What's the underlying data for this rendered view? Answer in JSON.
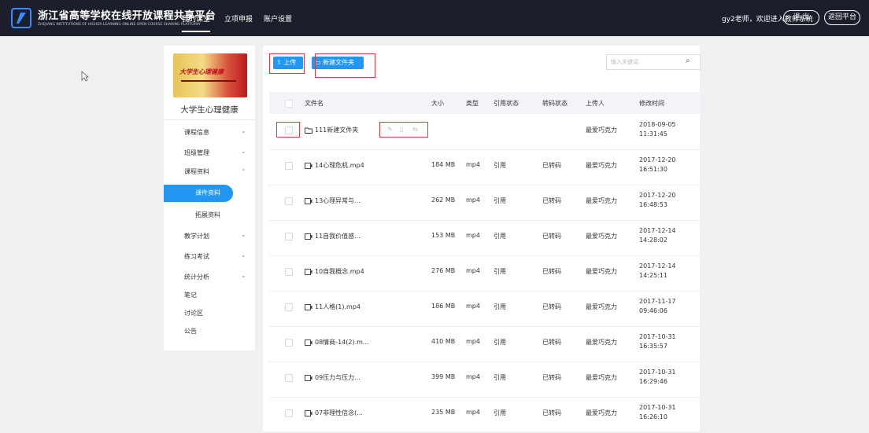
{
  "header": {
    "site_title": "浙江省高等学校在线开放课程共享平台",
    "site_subtitle": "ZHEJIANG INSTITUTIONS OF HIGHER LEARNING ONLINE OPEN COURSE SHARING PLATFORM",
    "nav": [
      "我的课堂",
      "立项申报",
      "账户设置"
    ],
    "welcome": "gy2老师，欢迎进入教师系统",
    "logout_label": "退 出",
    "return_label": "返回平台"
  },
  "sidebar": {
    "banner_text": "大学生心理健康",
    "course_name": "大学生心理健康",
    "menu": {
      "course_info": "课程信息",
      "class_mgmt": "班级管理",
      "materials": "课程资料",
      "courseware": "课件资料",
      "extended": "拓展资料",
      "teaching_plan": "教学计划",
      "exercises": "练习考试",
      "stats": "统计分析",
      "notes": "笔记",
      "discussion": "讨论区",
      "notice": "公告"
    }
  },
  "toolbar": {
    "upload_label": "上传",
    "new_folder_label": "新建文件夹",
    "search_placeholder": "输入关键词"
  },
  "table": {
    "headers": {
      "name": "文件名",
      "size": "大小",
      "type": "类型",
      "ref": "引用状态",
      "trans": "转码状态",
      "uploader": "上传人",
      "modified": "修改时间"
    },
    "rows": [
      {
        "name": "111新建文件夹",
        "size": "",
        "type": "",
        "ref": "",
        "trans": "",
        "uploader": "最爱巧克力",
        "date": "2018-09-05",
        "time": "11:31:45"
      },
      {
        "name": "14心理危机.mp4",
        "size": "184 MB",
        "type": "mp4",
        "ref": "引用",
        "trans": "已转码",
        "uploader": "最爱巧克力",
        "date": "2017-12-20",
        "time": "16:51:30"
      },
      {
        "name": "13心理异常与...",
        "size": "262 MB",
        "type": "mp4",
        "ref": "引用",
        "trans": "已转码",
        "uploader": "最爱巧克力",
        "date": "2017-12-20",
        "time": "16:48:53"
      },
      {
        "name": "11自我价值感...",
        "size": "153 MB",
        "type": "mp4",
        "ref": "引用",
        "trans": "已转码",
        "uploader": "最爱巧克力",
        "date": "2017-12-14",
        "time": "14:28:02"
      },
      {
        "name": "10自我概念.mp4",
        "size": "276 MB",
        "type": "mp4",
        "ref": "引用",
        "trans": "已转码",
        "uploader": "最爱巧克力",
        "date": "2017-12-14",
        "time": "14:25:11"
      },
      {
        "name": "11人格(1).mp4",
        "size": "186 MB",
        "type": "mp4",
        "ref": "引用",
        "trans": "已转码",
        "uploader": "最爱巧克力",
        "date": "2017-11-17",
        "time": "09:46:06"
      },
      {
        "name": "08情商-14(2).m...",
        "size": "410 MB",
        "type": "mp4",
        "ref": "引用",
        "trans": "已转码",
        "uploader": "最爱巧克力",
        "date": "2017-10-31",
        "time": "16:35:57"
      },
      {
        "name": "09压力与压力...",
        "size": "399 MB",
        "type": "mp4",
        "ref": "引用",
        "trans": "已转码",
        "uploader": "最爱巧克力",
        "date": "2017-10-31",
        "time": "16:29:46"
      },
      {
        "name": "07非理性信念(...",
        "size": "235 MB",
        "type": "mp4",
        "ref": "引用",
        "trans": "已转码",
        "uploader": "最爱巧克力",
        "date": "2017-10-31",
        "time": "16:26:10"
      }
    ]
  }
}
